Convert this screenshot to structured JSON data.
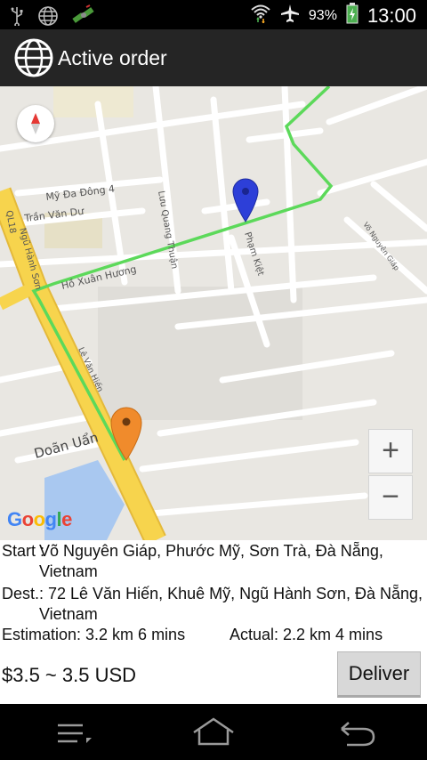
{
  "status_bar": {
    "battery": "93%",
    "time": "13:00",
    "icons": [
      "usb-icon",
      "globe-icon",
      "satellite-icon",
      "wifi-icon",
      "airplane-mode-icon",
      "battery-charging-icon"
    ]
  },
  "action_bar": {
    "title": "Active order",
    "icon": "globe-icon"
  },
  "map": {
    "streets": [
      "Mỹ Đa Đông 4",
      "Trần Văn Dư",
      "Lưu Quang Thuận",
      "Phạm Kiệt",
      "Võ Nguyên Giáp",
      "QL18",
      "Ngũ Hành Sơn",
      "Hồ Xuân Hương",
      "Lê Văn Hiến",
      "Doãn Uẩn"
    ],
    "zoom_in_label": "+",
    "zoom_out_label": "−",
    "attribution": [
      "G",
      "o",
      "o",
      "g",
      "l",
      "e"
    ],
    "colors": {
      "route": "#5cd95a",
      "major_road": "#f7d44d",
      "start_marker": "#2d3fd8",
      "dest_marker": "#f08b2c",
      "water": "#a9c8f0"
    }
  },
  "order": {
    "start_label": "Start :",
    "start_line1": "Võ Nguyên Giáp, Phước Mỹ, Sơn Trà, Đà Nẵng,",
    "start_line2": "Vietnam",
    "dest_label": "Dest.:",
    "dest_line1": "72 Lê Văn Hiến, Khuê Mỹ, Ngũ Hành Sơn, Đà Nẵng,",
    "dest_line2": "Vietnam",
    "estimation": "Estimation: 3.2 km 6 mins",
    "actual": "Actual: 2.2 km 4 mins",
    "price": "$3.5 ~ 3.5 USD",
    "deliver_label": "Deliver"
  },
  "nav_bar": {
    "icons": [
      "menu-icon",
      "home-icon",
      "back-icon"
    ]
  }
}
